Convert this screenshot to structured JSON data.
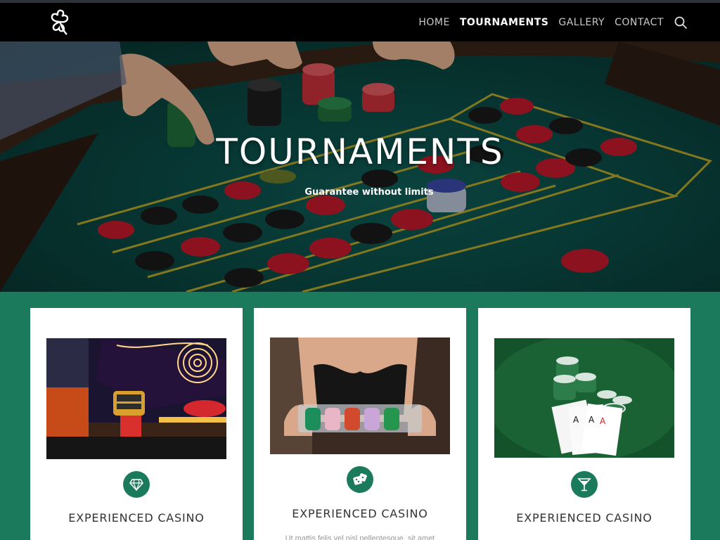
{
  "nav": {
    "items": [
      {
        "label": "HOME",
        "active": false
      },
      {
        "label": "TOURNAMENTS",
        "active": true
      },
      {
        "label": "GALLERY",
        "active": false
      },
      {
        "label": "CONTACT",
        "active": false
      }
    ],
    "logo_icon": "shamrock-icon",
    "search_icon": "search-icon"
  },
  "hero": {
    "title": "TOURNAMENTS",
    "subtitle": "Guarantee without limits"
  },
  "cards": [
    {
      "title": "EXPERIENCED CASINO",
      "icon": "diamond-icon",
      "image": "casino-street-neon"
    },
    {
      "title": "EXPERIENCED CASINO",
      "icon": "dice-icon",
      "image": "chip-tray"
    },
    {
      "title": "EXPERIENCED CASINO",
      "icon": "cocktail-icon",
      "image": "chips-and-cards"
    }
  ],
  "card2_text": "Ut mattis felis vel nisl pellentesque, sit amet",
  "colors": {
    "accent": "#1b7a5c",
    "navbar": "#000000",
    "felt": "#0f5d57"
  }
}
